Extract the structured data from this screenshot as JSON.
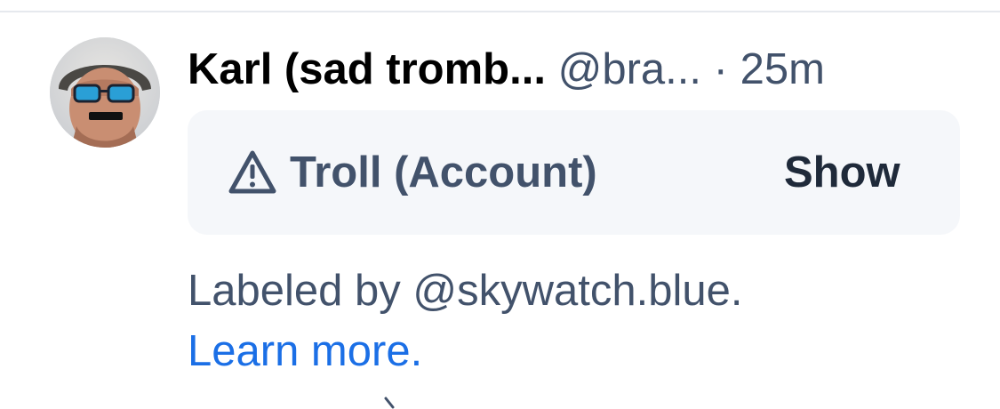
{
  "post": {
    "author_name": "Karl (sad tromb...",
    "author_handle": "@bra...",
    "separator": "·",
    "time": "25m"
  },
  "label_card": {
    "icon": "warning-triangle-icon",
    "label": "Troll (Account)",
    "show_label": "Show"
  },
  "labeler_notice": {
    "text": "Labeled by @skywatch.blue.",
    "learn_more": "Learn more."
  },
  "colors": {
    "primary_text": "#000000",
    "secondary_text": "#42526b",
    "link": "#1b6fe6",
    "card_background": "#f5f7fa"
  }
}
